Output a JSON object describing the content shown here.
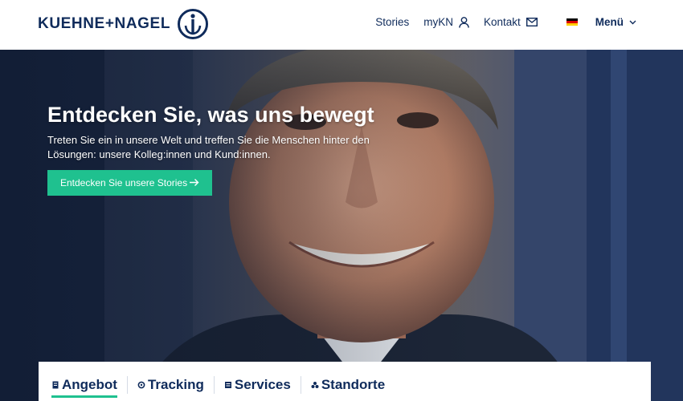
{
  "header": {
    "logo_text": "KUEHNE+NAGEL",
    "nav": {
      "stories": "Stories",
      "mykn": "myKN",
      "kontakt": "Kontakt",
      "menu": "Menü"
    },
    "flag_colors": [
      "#000000",
      "#dd0000",
      "#ffce00"
    ]
  },
  "hero": {
    "title": "Entdecken Sie, was uns bewegt",
    "subtitle": "Treten Sie ein in unsere Welt und treffen Sie die Menschen hinter den Lösungen: unsere Kolleg:innen und Kund:innen.",
    "cta_label": "Entdecken Sie unsere Stories"
  },
  "tabs": [
    {
      "label": "Angebot",
      "icon": "document-icon",
      "active": true
    },
    {
      "label": "Tracking",
      "icon": "tracking-icon",
      "active": false
    },
    {
      "label": "Services",
      "icon": "services-icon",
      "active": false
    },
    {
      "label": "Standorte",
      "icon": "locations-icon",
      "active": false
    }
  ],
  "colors": {
    "brand_navy": "#0f2b5b",
    "accent_green": "#1fc18f"
  }
}
